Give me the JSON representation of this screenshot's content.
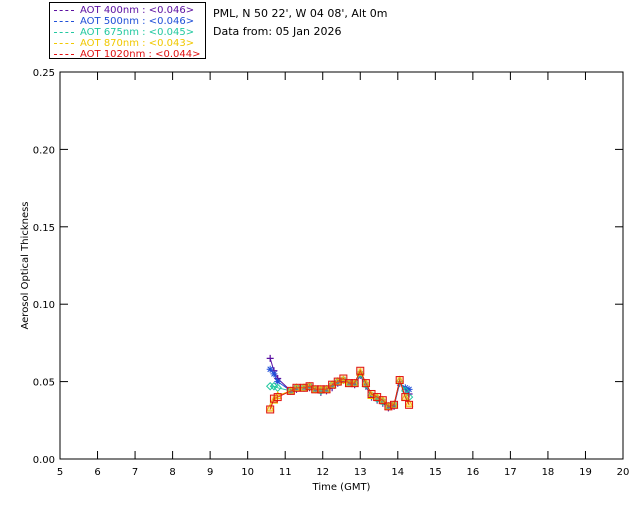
{
  "header": {
    "site": "PML, N 50 22', W 04 08', Alt 0m",
    "date": "Data from: 05 Jan 2026"
  },
  "chart_data": {
    "type": "scatter",
    "xlabel": "Time (GMT)",
    "ylabel": "Aerosol Optical Thickness",
    "xlim": [
      5,
      20
    ],
    "ylim": [
      0,
      0.25
    ],
    "xticks": [
      "5",
      "6",
      "7",
      "8",
      "9",
      "10",
      "11",
      "12",
      "13",
      "14",
      "15",
      "16",
      "17",
      "18",
      "19",
      "20"
    ],
    "yticks": [
      "0.00",
      "0.05",
      "0.10",
      "0.15",
      "0.20",
      "0.25"
    ],
    "legend_position": "top-left, outside plot",
    "series": [
      {
        "name": "AOT  400nm : <0.046>",
        "color": "#5a0fa0",
        "marker": "plus",
        "x": [
          10.6,
          10.7,
          10.8,
          11.15,
          11.3,
          11.5,
          11.65,
          11.8,
          11.95,
          12.1,
          12.25,
          12.4,
          12.55,
          12.7,
          12.85,
          13.0,
          13.15,
          13.3,
          13.45,
          13.6,
          13.75,
          13.9,
          14.05,
          14.2,
          14.3
        ],
        "y": [
          0.065,
          0.057,
          0.052,
          0.044,
          0.045,
          0.046,
          0.046,
          0.045,
          0.043,
          0.044,
          0.046,
          0.049,
          0.051,
          0.049,
          0.048,
          0.054,
          0.047,
          0.04,
          0.038,
          0.036,
          0.033,
          0.034,
          0.049,
          0.045,
          0.042
        ]
      },
      {
        "name": "AOT  500nm : <0.046>",
        "color": "#1f4fd8",
        "marker": "star",
        "x": [
          10.6,
          10.7,
          10.8,
          11.15,
          11.3,
          11.5,
          11.65,
          11.8,
          11.95,
          12.1,
          12.25,
          12.4,
          12.55,
          12.7,
          12.85,
          13.0,
          13.15,
          13.3,
          13.45,
          13.6,
          13.75,
          13.9,
          14.05,
          14.2,
          14.3
        ],
        "y": [
          0.058,
          0.055,
          0.05,
          0.044,
          0.046,
          0.046,
          0.047,
          0.045,
          0.044,
          0.045,
          0.047,
          0.049,
          0.051,
          0.049,
          0.049,
          0.055,
          0.048,
          0.041,
          0.039,
          0.037,
          0.034,
          0.035,
          0.049,
          0.046,
          0.045
        ]
      },
      {
        "name": "AOT  675nm : <0.045>",
        "color": "#22c8a0",
        "marker": "diamond",
        "x": [
          10.6,
          10.7,
          10.8,
          11.15,
          11.3,
          11.5,
          11.65,
          11.8,
          11.95,
          12.1,
          12.25,
          12.4,
          12.55,
          12.7,
          12.85,
          13.0,
          13.15,
          13.3,
          13.45,
          13.6,
          13.75,
          13.9,
          14.05,
          14.2,
          14.3
        ],
        "y": [
          0.047,
          0.047,
          0.046,
          0.044,
          0.046,
          0.046,
          0.047,
          0.045,
          0.044,
          0.045,
          0.048,
          0.05,
          0.051,
          0.049,
          0.049,
          0.055,
          0.048,
          0.041,
          0.039,
          0.037,
          0.034,
          0.035,
          0.05,
          0.044,
          0.04
        ]
      },
      {
        "name": "AOT  870nm : <0.043>",
        "color": "#f0c800",
        "marker": "triangle",
        "x": [
          10.6,
          10.7,
          10.8,
          11.15,
          11.3,
          11.5,
          11.65,
          11.8,
          11.95,
          12.1,
          12.25,
          12.4,
          12.55,
          12.7,
          12.85,
          13.0,
          13.15,
          13.3,
          13.45,
          13.6,
          13.75,
          13.9,
          14.05,
          14.2,
          14.3
        ],
        "y": [
          0.033,
          0.038,
          0.041,
          0.044,
          0.046,
          0.046,
          0.047,
          0.045,
          0.045,
          0.045,
          0.048,
          0.05,
          0.051,
          0.049,
          0.049,
          0.056,
          0.049,
          0.041,
          0.04,
          0.038,
          0.034,
          0.035,
          0.051,
          0.04,
          0.036
        ]
      },
      {
        "name": "AOT 1020nm : <0.044>",
        "color": "#e01010",
        "marker": "square",
        "x": [
          10.6,
          10.7,
          10.8,
          11.15,
          11.3,
          11.5,
          11.65,
          11.8,
          11.95,
          12.1,
          12.25,
          12.4,
          12.55,
          12.7,
          12.85,
          13.0,
          13.15,
          13.3,
          13.45,
          13.6,
          13.75,
          13.9,
          14.05,
          14.2,
          14.3
        ],
        "y": [
          0.032,
          0.039,
          0.04,
          0.044,
          0.046,
          0.046,
          0.047,
          0.045,
          0.045,
          0.045,
          0.048,
          0.05,
          0.052,
          0.049,
          0.049,
          0.057,
          0.049,
          0.042,
          0.04,
          0.038,
          0.034,
          0.035,
          0.051,
          0.04,
          0.035
        ]
      }
    ]
  }
}
